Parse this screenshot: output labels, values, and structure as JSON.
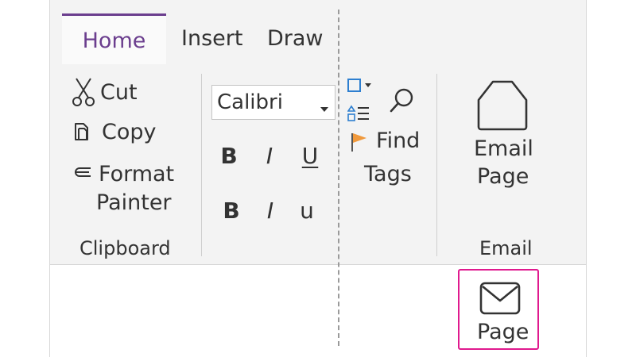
{
  "tabs": [
    {
      "label": "Home",
      "active": true
    },
    {
      "label": "Insert",
      "active": false
    },
    {
      "label": "Draw",
      "active": false
    }
  ],
  "clipboard": {
    "cut_label": "Cut",
    "copy_label": "Copy",
    "format_painter_line1": "Format",
    "format_painter_line2": "Painter",
    "group_label": "Clipboard"
  },
  "font": {
    "font_name": "Calibri",
    "row1": [
      "B",
      "I",
      "U"
    ],
    "row2": [
      "B",
      "I",
      "u"
    ]
  },
  "tags": {
    "find_label": "Find",
    "tags_label": "Tags"
  },
  "email": {
    "line1": "Email",
    "line2": "Page",
    "group_label": "Email"
  },
  "highlighted": {
    "label": "Page"
  },
  "colors": {
    "accent": "#6b3e8e",
    "highlight_border": "#e0198e",
    "tag_icon_blue": "#2e7fd0",
    "flag_orange": "#f0993c"
  },
  "icons": {
    "cut": "scissors-icon",
    "copy": "copy-icon",
    "format_painter": "format-painter-icon",
    "find": "search-icon",
    "tags": "flag-icon",
    "email_page": "email-page-icon",
    "envelope": "envelope-icon"
  }
}
